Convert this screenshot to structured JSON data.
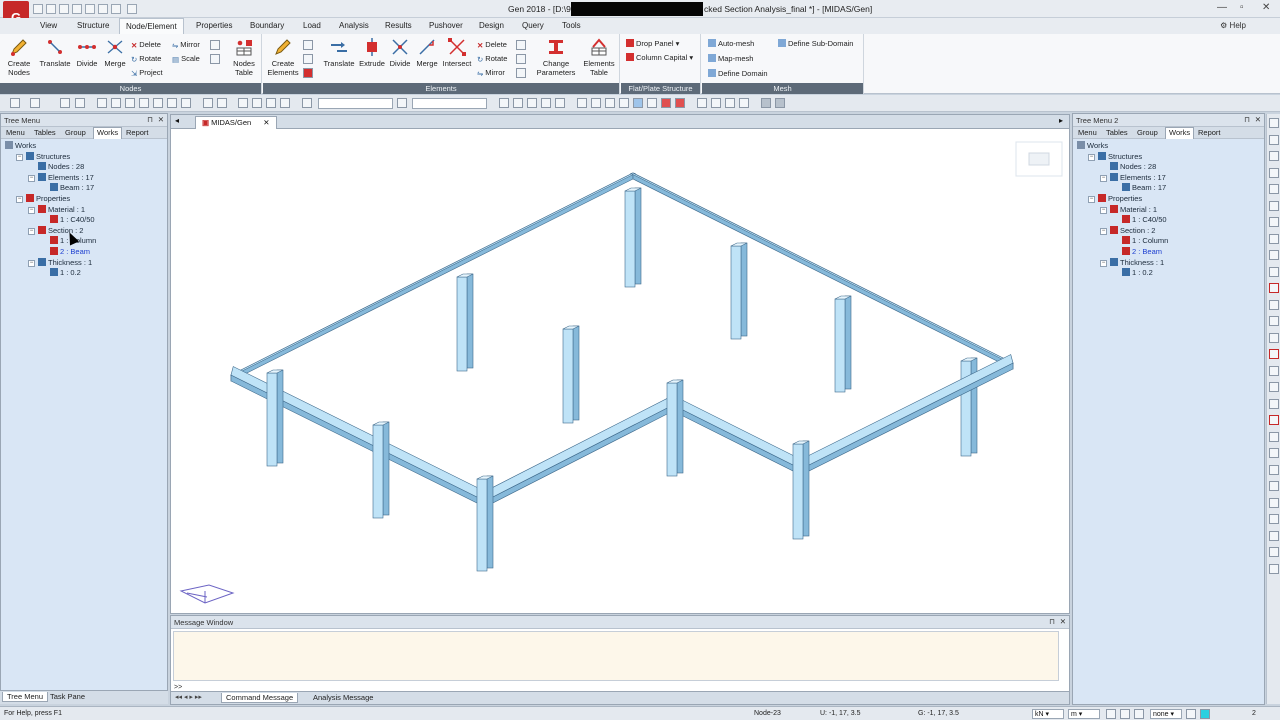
{
  "window": {
    "title_left": "Gen 2018 - [D:\\91",
    "title_right": "cked Section Analysis_final *] - [MIDAS/Gen]",
    "app_icon_text": "G",
    "controls": [
      "—",
      "▫",
      "✕"
    ]
  },
  "menu": {
    "tabs": [
      "View",
      "Structure",
      "Node/Element",
      "Properties",
      "Boundary",
      "Load",
      "Analysis",
      "Results",
      "Pushover",
      "Design",
      "Query",
      "Tools"
    ],
    "active": "Node/Element",
    "help": "Help"
  },
  "ribbon": {
    "groups": [
      {
        "label": "Nodes"
      },
      {
        "label": "Elements"
      },
      {
        "label": "Flat/Plate Structure"
      },
      {
        "label": "Mesh"
      }
    ],
    "nodes": {
      "create": "Create\nNodes",
      "translate": "Translate",
      "divide": "Divide",
      "merge": "Merge",
      "delete": "Delete",
      "rotate": "Rotate",
      "project": "Project",
      "mirror": "Mirror",
      "scale": "Scale",
      "table": "Nodes\nTable"
    },
    "elements": {
      "create": "Create\nElements",
      "translate": "Translate",
      "extrude": "Extrude",
      "divide": "Divide",
      "merge": "Merge",
      "intersect": "Intersect",
      "delete": "Delete",
      "rotate": "Rotate",
      "mirror": "Mirror",
      "change_params": "Change\nParameters",
      "table": "Elements\nTable"
    },
    "flat": {
      "drop_panel": "Drop Panel",
      "column_capital": "Column Capital"
    },
    "mesh": {
      "auto_mesh": "Auto-mesh",
      "map_mesh": "Map-mesh",
      "define_domain": "Define Domain",
      "define_sub_domain": "Define Sub-Domain"
    }
  },
  "tree_left": {
    "title": "Tree Menu",
    "tabs": [
      "Menu",
      "Tables",
      "Group",
      "Works",
      "Report"
    ],
    "active_tab": "Works",
    "nodes": [
      {
        "text": "Works",
        "indent": 0
      },
      {
        "text": "Structures",
        "indent": 1
      },
      {
        "text": "Nodes : 28",
        "indent": 2
      },
      {
        "text": "Elements : 17",
        "indent": 2
      },
      {
        "text": "Beam : 17",
        "indent": 3
      },
      {
        "text": "Properties",
        "indent": 1
      },
      {
        "text": "Material : 1",
        "indent": 2
      },
      {
        "text": "1 : C40/50",
        "indent": 3
      },
      {
        "text": "Section : 2",
        "indent": 2
      },
      {
        "text": "1 : Column",
        "indent": 3
      },
      {
        "text": "2 : Beam",
        "indent": 3
      },
      {
        "text": "Thickness : 1",
        "indent": 2
      },
      {
        "text": "1 : 0.2",
        "indent": 3
      }
    ],
    "bottom_tabs": [
      "Tree Menu",
      "Task Pane"
    ]
  },
  "tree_right": {
    "title": "Tree Menu 2",
    "tabs": [
      "Menu",
      "Tables",
      "Group",
      "Works",
      "Report"
    ],
    "active_tab": "Works",
    "nodes": [
      {
        "text": "Works",
        "indent": 0
      },
      {
        "text": "Structures",
        "indent": 1
      },
      {
        "text": "Nodes : 28",
        "indent": 2
      },
      {
        "text": "Elements : 17",
        "indent": 2
      },
      {
        "text": "Beam : 17",
        "indent": 3
      },
      {
        "text": "Properties",
        "indent": 1
      },
      {
        "text": "Material : 1",
        "indent": 2
      },
      {
        "text": "1 : C40/50",
        "indent": 3
      },
      {
        "text": "Section : 2",
        "indent": 2
      },
      {
        "text": "1 : Column",
        "indent": 3
      },
      {
        "text": "2 : Beam",
        "indent": 3
      },
      {
        "text": "Thickness : 1",
        "indent": 2
      },
      {
        "text": "1 : 0.2",
        "indent": 3
      }
    ]
  },
  "viewport": {
    "tab": "MIDAS/Gen"
  },
  "message_window": {
    "title": "Message Window",
    "prompt": ">>",
    "tabs": [
      "Command Message",
      "Analysis Message"
    ],
    "active_tab": "Command Message"
  },
  "status": {
    "help": "For Help, press F1",
    "node": "Node-23",
    "u": "U: -1, 17, 3.5",
    "g": "G: -1, 17, 3.5",
    "force_unit": "kN",
    "length_unit": "m",
    "none": "none",
    "page": "2"
  },
  "colors": {
    "member_fill": "#bfe3f7",
    "member_dark": "#86b9da",
    "member_stroke": "#3f6a8c",
    "tree_bg": "#d9e6f5",
    "ribbon_label_bg": "#5d6a78",
    "app_icon": "#c62828"
  }
}
